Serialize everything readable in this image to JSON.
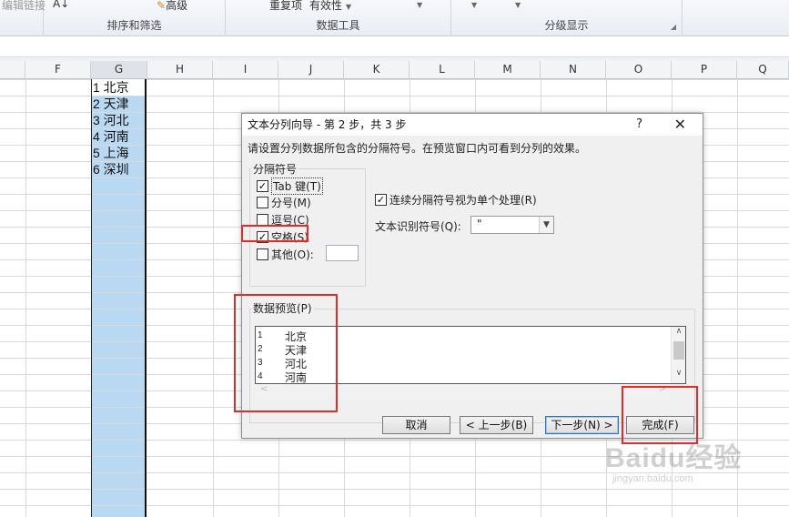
{
  "ribbon": {
    "left_tool": "编辑链接",
    "az_label": "A↓",
    "advanced_label": "高级",
    "remove_dup_label": "重复项",
    "validity_label": "有效性",
    "group_sort": "排序和筛选",
    "group_data_tools": "数据工具",
    "group_outline": "分级显示"
  },
  "columns": [
    "F",
    "G",
    "H",
    "I",
    "J",
    "K",
    "L",
    "M",
    "N",
    "O",
    "P",
    "Q"
  ],
  "cells": [
    "1 北京",
    "2 天津",
    "3 河北",
    "4 河南",
    "5 上海",
    "6 深圳"
  ],
  "dialog": {
    "title": "文本分列向导 - 第 2 步，共 3 步",
    "help": "?",
    "close": "✕",
    "instruction": "请设置分列数据所包含的分隔符号。在预览窗口内可看到分列的效果。",
    "delimiters_legend": "分隔符号",
    "delimiters": [
      {
        "label": "Tab 键(T)",
        "checked": true
      },
      {
        "label": "分号(M)",
        "checked": false
      },
      {
        "label": "逗号(C)",
        "checked": false
      },
      {
        "label": "空格(S)",
        "checked": true
      },
      {
        "label": "其他(O):",
        "checked": false
      }
    ],
    "consecutive_label": "连续分隔符号视为单个处理(R)",
    "consecutive_checked": true,
    "qualifier_label": "文本识别符号(Q):",
    "qualifier_value": "\"",
    "preview_legend": "数据预览(P)",
    "preview_rows": [
      {
        "num": "1",
        "city": "北京"
      },
      {
        "num": "2",
        "city": "天津"
      },
      {
        "num": "3",
        "city": "河北"
      },
      {
        "num": "4",
        "city": "河南"
      }
    ],
    "buttons": {
      "cancel": "取消",
      "back": "< 上一步(B)",
      "next": "下一步(N) >",
      "finish": "完成(F)"
    }
  },
  "watermark": {
    "brand": "Baidu经验",
    "url": "jingyan.baidu.com"
  },
  "colors": {
    "selection": "#b9d8f2",
    "highlight": "#e52a2a",
    "primary_border": "#2f6fce"
  }
}
